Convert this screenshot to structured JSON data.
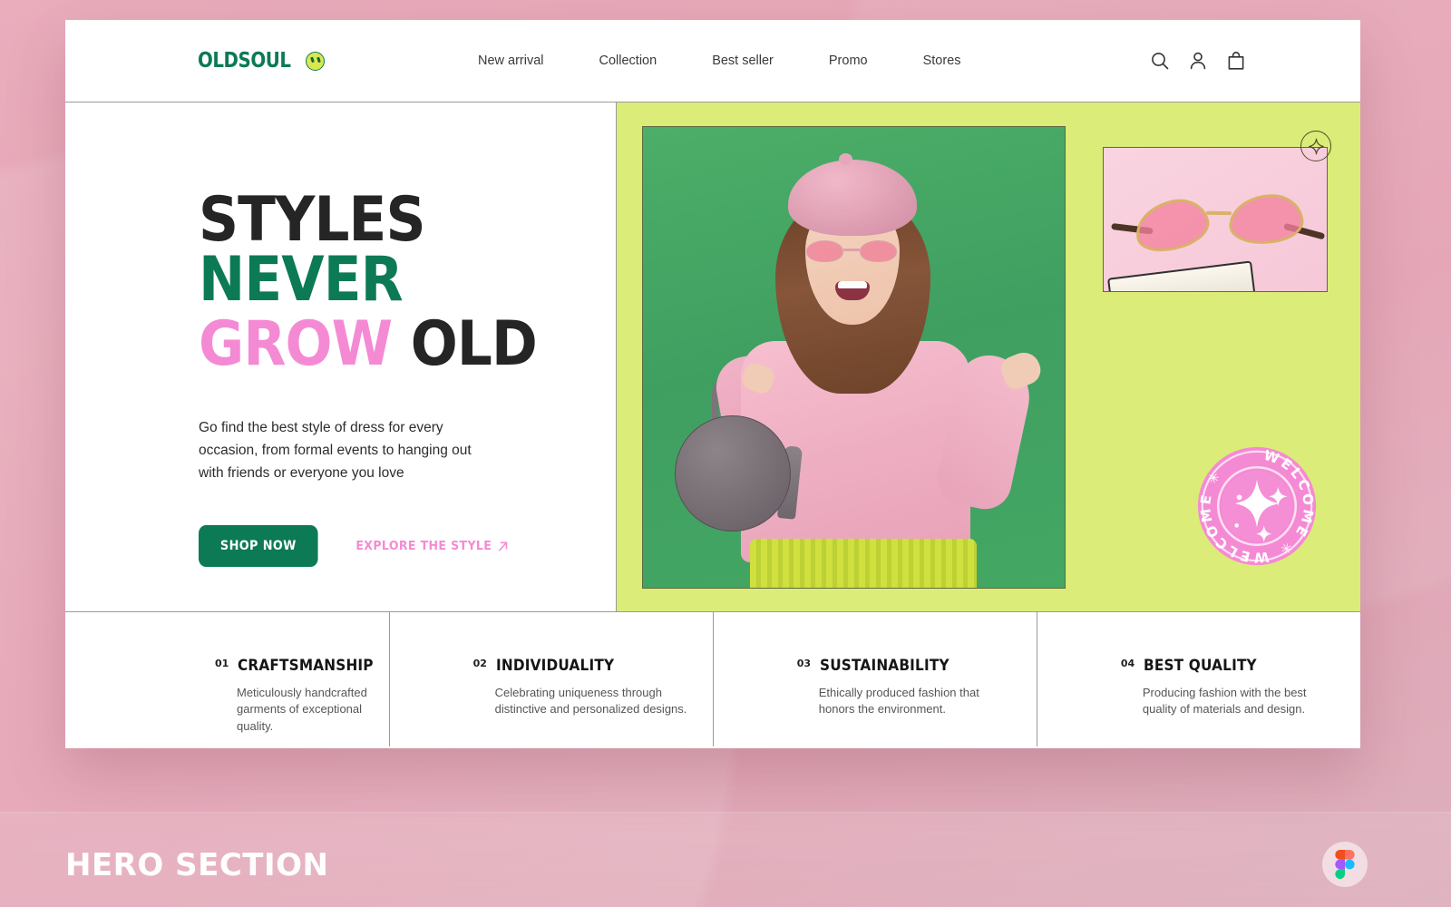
{
  "brand": {
    "name": "OLDSOUL",
    "logo_icon": "smiley-face-icon",
    "color": "#0c7a55"
  },
  "nav": {
    "items": [
      {
        "label": "New arrival"
      },
      {
        "label": "Collection"
      },
      {
        "label": "Best seller"
      },
      {
        "label": "Promo"
      },
      {
        "label": "Stores"
      }
    ]
  },
  "header_icons": [
    {
      "name": "search-icon"
    },
    {
      "name": "user-account-icon"
    },
    {
      "name": "shopping-bag-icon"
    }
  ],
  "hero": {
    "headline": {
      "line1_part1": "STYLES",
      "line1_part2": "NEVER",
      "line2_part1": "GROW",
      "line2_part2": "OLD",
      "color_dark": "#252525",
      "color_green": "#0c7a55",
      "color_pink": "#f58ad4"
    },
    "subcopy": "Go find the best style of dress for every occasion, from formal events to hanging out with friends or everyone you love",
    "primary_button": "SHOP NOW",
    "secondary_link": "EXPLORE THE STYLE",
    "secondary_link_icon": "arrow-up-right-icon",
    "panel_color": "#dcec78",
    "photo_bg_color": "#47a863",
    "sparkle_badge_icon": "sparkle-star-icon",
    "stamp": {
      "text": "WELCOME",
      "repeat_text": "WELCOME ✳ WELCOME ✳",
      "color": "#f58ad4"
    }
  },
  "features": [
    {
      "number": "01",
      "title": "CRAFTSMANSHIP",
      "desc": "Meticulously handcrafted garments of exceptional quality."
    },
    {
      "number": "02",
      "title": "INDIVIDUALITY",
      "desc": "Celebrating uniqueness through distinctive and personalized designs."
    },
    {
      "number": "03",
      "title": "SUSTAINABILITY",
      "desc": "Ethically produced fashion that honors the environment."
    },
    {
      "number": "04",
      "title": "BEST QUALITY",
      "desc": "Producing fashion with the best quality of materials and design."
    }
  ],
  "footer": {
    "label": "HERO SECTION",
    "badge_icon": "figma-logo-icon"
  }
}
